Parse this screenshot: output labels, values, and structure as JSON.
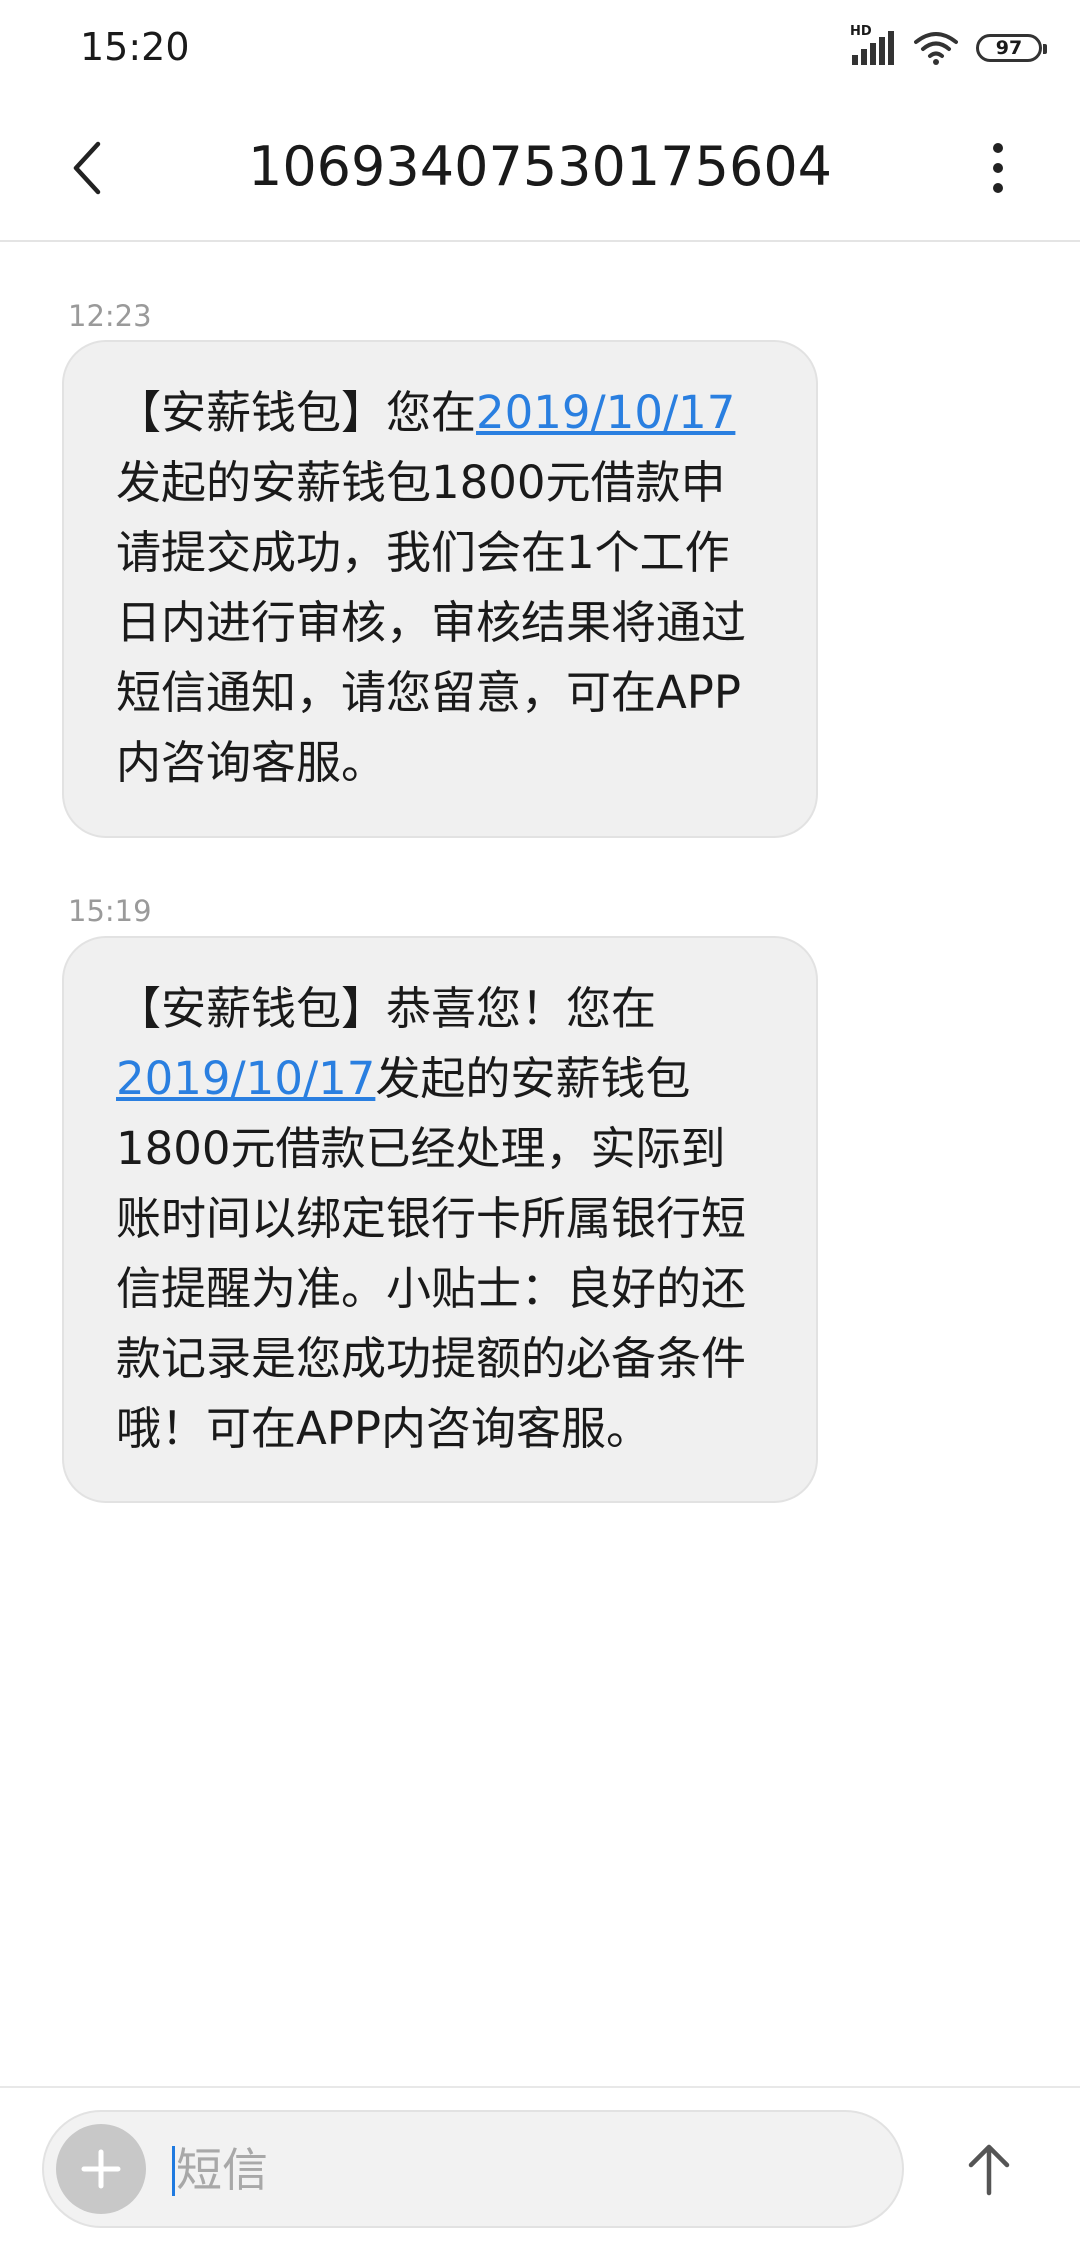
{
  "status_bar": {
    "time": "15:20",
    "network_label": "HD",
    "battery_level": "97"
  },
  "header": {
    "title": "10693407530175604"
  },
  "messages": [
    {
      "time": "12:23",
      "segments": [
        {
          "text": "【安薪钱包】您在"
        },
        {
          "text": "2019/10/17",
          "link": true
        },
        {
          "text": "发起的安薪钱包1800元借款申请提交成功，我们会在1个工作日内进行审核，审核结果将通过短信通知，请您留意，可在APP内咨询客服。"
        }
      ]
    },
    {
      "time": "15:19",
      "segments": [
        {
          "text": "【安薪钱包】恭喜您！您在"
        },
        {
          "text": "2019/10/17",
          "link": true
        },
        {
          "text": "发起的安薪钱包1800元借款已经处理，实际到账时间以绑定银行卡所属银行短信提醒为准。小贴士：良好的还款记录是您成功提额的必备条件哦！可在APP内咨询客服。"
        }
      ]
    }
  ],
  "composer": {
    "placeholder": "短信"
  },
  "icons": {
    "back": "chevron-left-icon",
    "more": "more-vertical-icon",
    "add": "plus-icon",
    "send": "arrow-up-icon",
    "signal": "signal-icon",
    "wifi": "wifi-icon",
    "battery": "battery-icon"
  },
  "colors": {
    "link": "#2a7fe0",
    "bubble_background": "#f0f0f0",
    "timestamp": "#9a9a9a",
    "caret": "#1f7ae0"
  }
}
